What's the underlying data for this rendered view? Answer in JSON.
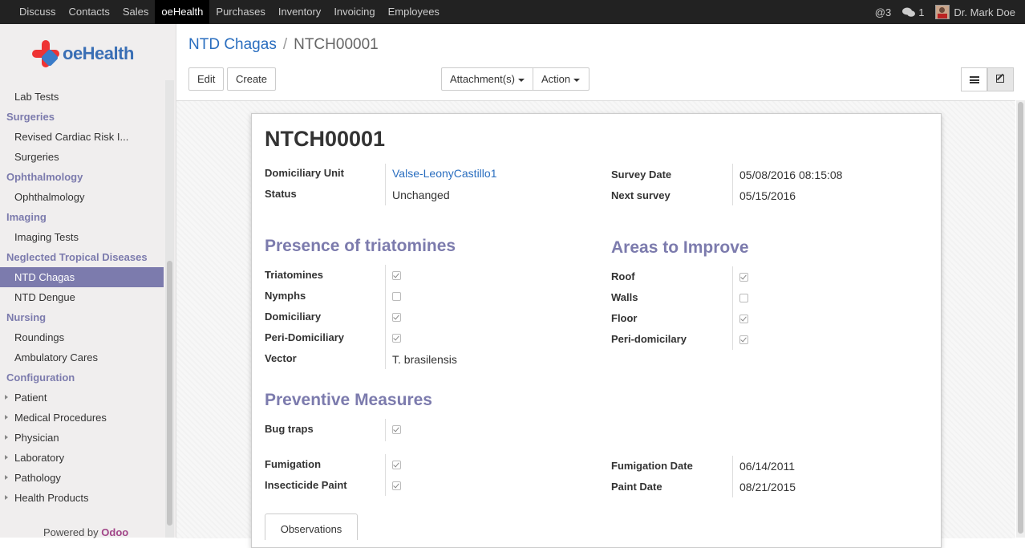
{
  "topbar": {
    "menu": [
      "Discuss",
      "Contacts",
      "Sales",
      "oeHealth",
      "Purchases",
      "Inventory",
      "Invoicing",
      "Employees"
    ],
    "active": "oeHealth",
    "mentions": "@3",
    "messages": "1",
    "user": "Dr. Mark Doe"
  },
  "sidebar": {
    "logo_text": "oeHealth",
    "lab_tests": "Lab Tests",
    "surgeries_h": "Surgeries",
    "revised_cardiac": "Revised Cardiac Risk I...",
    "surgeries": "Surgeries",
    "ophthalmology_h": "Ophthalmology",
    "ophthalmology": "Ophthalmology",
    "imaging_h": "Imaging",
    "imaging_tests": "Imaging Tests",
    "ntd_h": "Neglected Tropical Diseases",
    "ntd_chagas": "NTD Chagas",
    "ntd_dengue": "NTD Dengue",
    "nursing_h": "Nursing",
    "roundings": "Roundings",
    "ambulatory": "Ambulatory Cares",
    "config_h": "Configuration",
    "patient": "Patient",
    "medical_procedures": "Medical Procedures",
    "physician": "Physician",
    "laboratory": "Laboratory",
    "pathology": "Pathology",
    "health_products": "Health Products",
    "powered_prefix": "Powered by",
    "powered_brand": "Odoo"
  },
  "breadcrumb": {
    "parent": "NTD Chagas",
    "current": "NTCH00001"
  },
  "buttons": {
    "edit": "Edit",
    "create": "Create",
    "attachments": "Attachment(s)",
    "action": "Action"
  },
  "form": {
    "title": "NTCH00001",
    "domiciliary_unit_label": "Domiciliary Unit",
    "domiciliary_unit": "Valse-LeonyCastillo1",
    "status_label": "Status",
    "status": "Unchanged",
    "survey_date_label": "Survey Date",
    "survey_date": "05/08/2016 08:15:08",
    "next_survey_label": "Next survey",
    "next_survey": "05/15/2016",
    "presence_title": "Presence of triatomines",
    "triatomines_label": "Triatomines",
    "triatomines": true,
    "nymphs_label": "Nymphs",
    "nymphs": false,
    "domiciliary_label": "Domiciliary",
    "domiciliary": true,
    "peri_domiciliary_label": "Peri-Domiciliary",
    "peri_domiciliary": true,
    "vector_label": "Vector",
    "vector": "T. brasilensis",
    "areas_title": "Areas to Improve",
    "roof_label": "Roof",
    "roof": true,
    "walls_label": "Walls",
    "walls": false,
    "floor_label": "Floor",
    "floor": true,
    "peri_domicilary_label": "Peri-domicilary",
    "peri_domicilary": true,
    "preventive_title": "Preventive Measures",
    "bug_traps_label": "Bug traps",
    "bug_traps": true,
    "fumigation_label": "Fumigation",
    "fumigation": true,
    "insecticide_label": "Insecticide Paint",
    "insecticide": true,
    "fumigation_date_label": "Fumigation Date",
    "fumigation_date": "06/14/2011",
    "paint_date_label": "Paint Date",
    "paint_date": "08/21/2015",
    "observations_tab": "Observations"
  }
}
